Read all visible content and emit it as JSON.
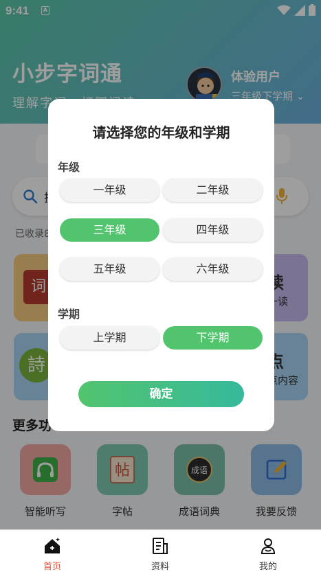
{
  "status_bar": {
    "time": "9:41",
    "indicator": "A"
  },
  "header": {
    "app_title": "小步字词通",
    "slogan": "理解字词，打冨阅读",
    "user_name": "体验用户",
    "user_grade": "三年级下学期"
  },
  "search": {
    "placeholder": "搜"
  },
  "stats": {
    "text": "已收录8"
  },
  "cards": {
    "ci_glyph": "词",
    "shi_glyph": "詩",
    "du_title": "读",
    "du_sub": "一读",
    "dian_title": "点",
    "dian_sub": "点内容"
  },
  "more": {
    "title": "更多功",
    "tools": [
      "智能听写",
      "字帖",
      "成语词典",
      "我要反馈"
    ],
    "tool_glyphs": {
      "zitie": "帖",
      "chengyu": "成语"
    }
  },
  "tabs": [
    {
      "label": "首页",
      "active": true
    },
    {
      "label": "资料",
      "active": false
    },
    {
      "label": "我的",
      "active": false
    }
  ],
  "dialog": {
    "title": "请选择您的年级和学期",
    "grade_label": "年级",
    "grades": [
      "一年级",
      "二年级",
      "三年级",
      "四年级",
      "五年级",
      "六年级"
    ],
    "selected_grade": "三年级",
    "term_label": "学期",
    "terms": [
      "上学期",
      "下学期"
    ],
    "selected_term": "下学期",
    "confirm_label": "确定"
  },
  "colors": {
    "accent_green": "#52c46e",
    "teal": "#36b99c",
    "tab_active": "#e0533d"
  }
}
